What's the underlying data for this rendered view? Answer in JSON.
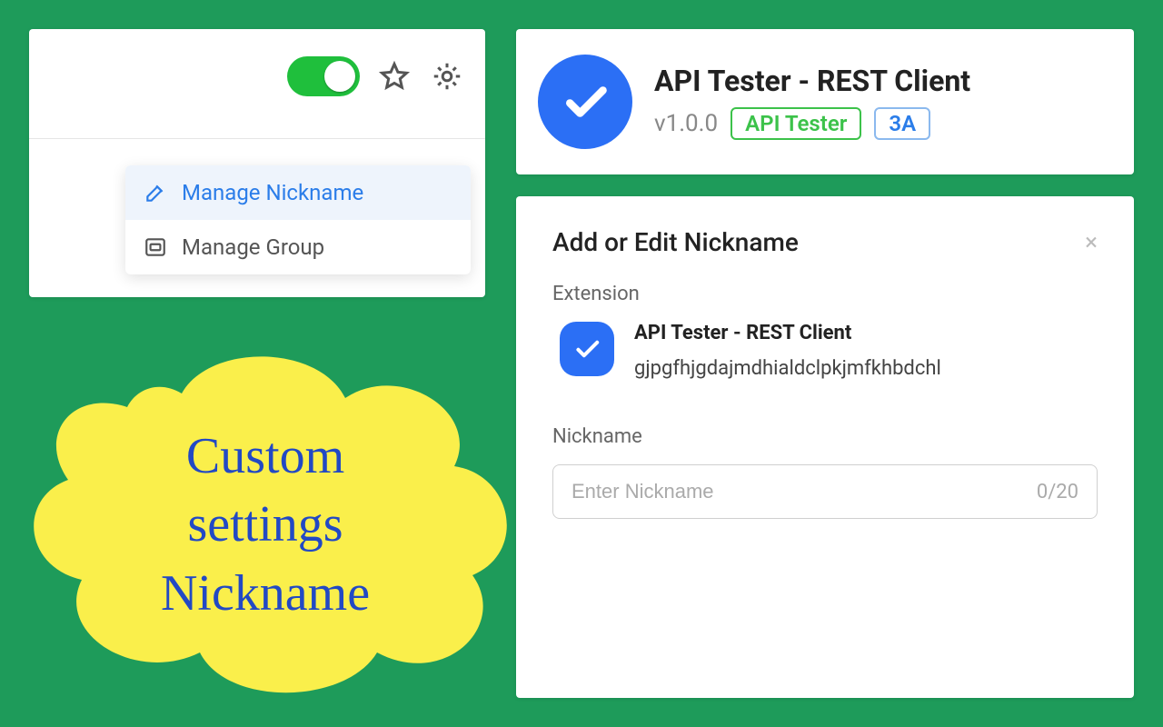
{
  "colors": {
    "bg": "#1e9b5a",
    "accent_blue": "#2b6ff5",
    "link_blue": "#2b7de9",
    "toggle_green": "#1fbf3c",
    "pill_green": "#3cc24a",
    "cloud_yellow": "#faef4b",
    "cloud_text": "#2249c4"
  },
  "topLeft": {
    "toggle_on": true,
    "menu": {
      "manage_nickname": "Manage Nickname",
      "manage_group": "Manage Group"
    }
  },
  "topRight": {
    "title": "API Tester - REST Client",
    "version": "v1.0.0",
    "badge_green": "API Tester",
    "badge_blue": "3A"
  },
  "dialog": {
    "title": "Add or Edit Nickname",
    "section_extension": "Extension",
    "ext_name": "API Tester - REST Client",
    "ext_id": "gjpgfhjgdajmdhialdclpkjmfkhbdchl",
    "section_nickname": "Nickname",
    "placeholder": "Enter Nickname",
    "counter": "0/20"
  },
  "cloud": {
    "text": "Custom\nsettings\nNickname"
  }
}
